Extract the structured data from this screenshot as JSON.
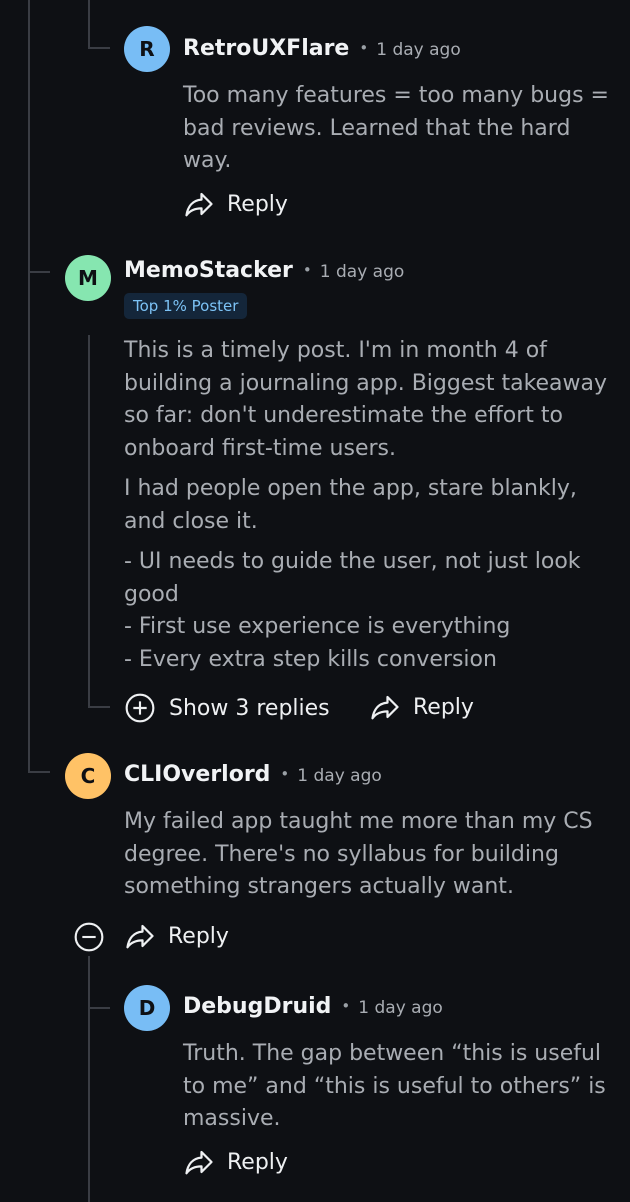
{
  "colors": {
    "background": "#0e1014",
    "thread_line": "#3a3d44",
    "avatar_blue": "#78bdf5",
    "avatar_green": "#86e6b0",
    "avatar_yellow": "#ffc266",
    "badge_bg": "#14263a",
    "badge_text": "#7cc2f5"
  },
  "comments": [
    {
      "initial": "R",
      "username": "RetroUXFlare",
      "separator": "•",
      "time": "1 day ago",
      "paragraphs": [
        "Too many features = too many bugs = bad reviews. Learned that the hard way."
      ],
      "reply_label": "Reply"
    },
    {
      "initial": "M",
      "username": "MemoStacker",
      "separator": "•",
      "time": "1 day ago",
      "badge": "Top 1% Poster",
      "paragraphs": [
        "This is a timely post. I'm in month 4 of building a journaling app. Biggest takeaway so far: don't underestimate the effort to onboard first-time users.",
        "I had people open the app, stare blankly, and close it.",
        "- UI needs to guide the user, not just look good",
        "- First use experience is everything",
        "- Every extra step kills conversion"
      ],
      "show_replies_label": "Show 3 replies",
      "reply_label": "Reply"
    },
    {
      "initial": "C",
      "username": "CLIOverlord",
      "separator": "•",
      "time": "1 day ago",
      "paragraphs": [
        "My failed app taught me more than my CS degree. There's no syllabus for building something strangers actually want."
      ],
      "reply_label": "Reply"
    },
    {
      "initial": "D",
      "username": "DebugDruid",
      "separator": "•",
      "time": "1 day ago",
      "paragraphs": [
        "Truth. The gap between “this is useful to me” and “this is useful to others” is massive."
      ],
      "reply_label": "Reply"
    }
  ],
  "icons": {
    "reply": "share-arrow-icon",
    "expand": "plus-circle-icon",
    "collapse": "minus-circle-icon"
  }
}
